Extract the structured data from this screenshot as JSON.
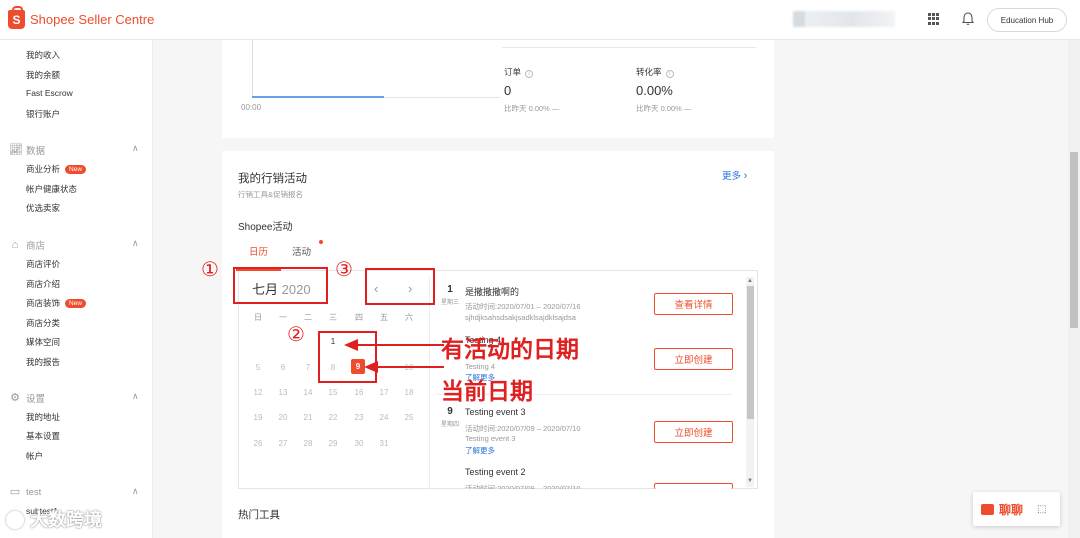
{
  "header": {
    "brand": "Shopee Seller Centre",
    "education_hub": "Education Hub",
    "icons": [
      "apps-grid-icon",
      "bell-icon"
    ]
  },
  "sidebar": {
    "finance_items": [
      "我的收入",
      "我的余额",
      "Fast Escrow",
      "银行账户"
    ],
    "data": {
      "title": "数据",
      "items": [
        "商业分析",
        "帐户健康状态",
        "优选卖家"
      ],
      "new_badge": "New"
    },
    "shop": {
      "title": "商店",
      "items": [
        "商店评价",
        "商店介绍",
        "商店装饰",
        "商店分类",
        "媒体空间",
        "我的报告"
      ],
      "new_badge": "New"
    },
    "settings": {
      "title": "设置",
      "items": [
        "我的地址",
        "基本设置",
        "帐户"
      ]
    },
    "test": {
      "title": "test",
      "items": [
        "subtest1"
      ]
    }
  },
  "stats": {
    "chart_time_label": "00:00",
    "orders": {
      "label": "订单",
      "value": "0",
      "compare": "比昨天 0.00% —"
    },
    "conversion": {
      "label": "转化率",
      "value": "0.00%",
      "compare": "比昨天 0.00% —"
    }
  },
  "marketing": {
    "title": "我的行销活动",
    "subtitle": "行销工具&促销报名",
    "more": "更多",
    "shopee_section": "Shopee活动",
    "tabs": [
      "日历",
      "活动"
    ],
    "calendar": {
      "month_label": "七月",
      "year": "2020",
      "weekdays": [
        "日",
        "一",
        "二",
        "三",
        "四",
        "五",
        "六"
      ],
      "rows": [
        [
          "",
          "",
          "",
          "1",
          "",
          "",
          ""
        ],
        [
          "5",
          "6",
          "7",
          "8",
          "9",
          "",
          "10"
        ],
        [
          "12",
          "13",
          "14",
          "15",
          "16",
          "17",
          "18"
        ],
        [
          "19",
          "20",
          "21",
          "22",
          "23",
          "24",
          "25"
        ],
        [
          "26",
          "27",
          "28",
          "29",
          "30",
          "31",
          ""
        ]
      ],
      "today": "9"
    },
    "events": [
      {
        "day": "1",
        "weekday": "星期三",
        "title": "是撒撒撒啊的",
        "period": "活动时间:2020/07/01 – 2020/07/16",
        "desc": "sjhdjksahsdsakjsadklsajdklsajdsa",
        "button": "查看详情"
      },
      {
        "day": "",
        "weekday": "",
        "title": "Testing 4",
        "period": "",
        "desc": "Testing 4",
        "link": "了解更多",
        "button": "立即创建"
      },
      {
        "day": "9",
        "weekday": "星期四",
        "title": "Testing event 3",
        "period": "活动时间:2020/07/09 – 2020/07/10",
        "desc": "Testing event 3",
        "link": "了解更多",
        "button": "立即创建"
      },
      {
        "day": "",
        "weekday": "",
        "title": "Testing event 2",
        "period": "活动时间:2020/07/09 – 2020/07/10",
        "desc": "",
        "button": ""
      }
    ]
  },
  "hot_tools": "热门工具",
  "chat": {
    "label": "聊聊"
  },
  "annotations": {
    "n1": "①",
    "n2": "②",
    "n3": "③",
    "event_dates": "有活动的日期",
    "current_date": "当前日期"
  },
  "watermark": "大数跨境",
  "colors": {
    "brand": "#ee4d2d",
    "annotation": "#e02020",
    "link": "#2673dd"
  }
}
